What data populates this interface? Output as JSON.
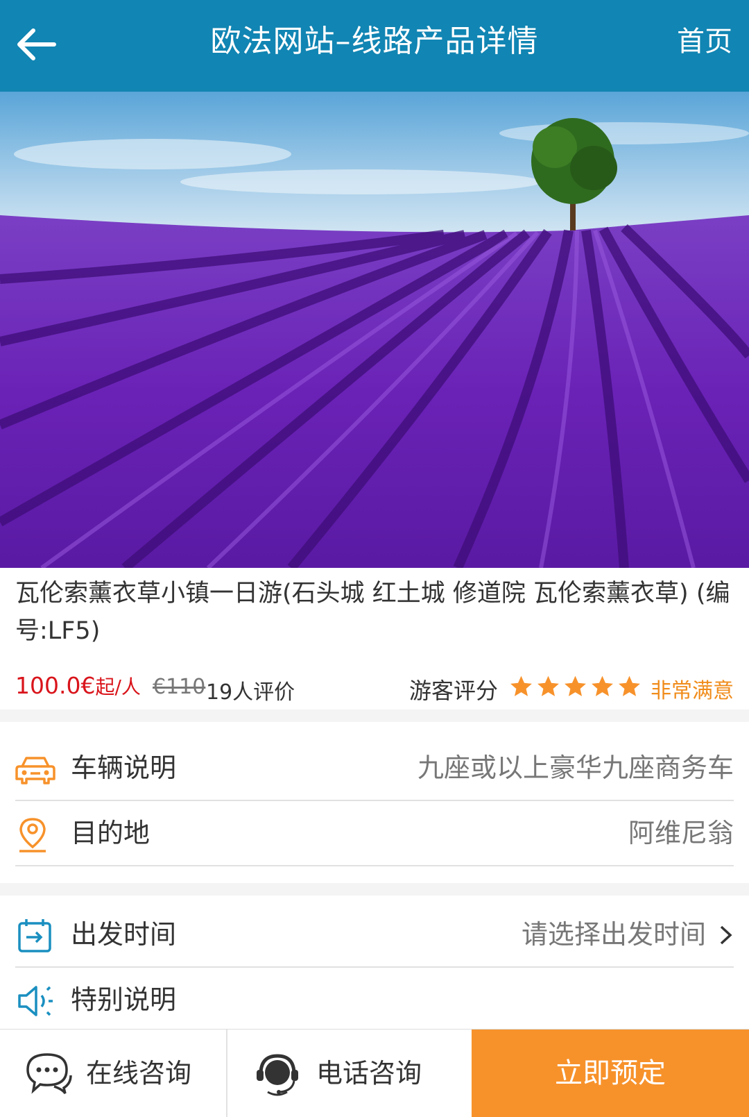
{
  "header": {
    "title": "欧法网站–线路产品详情",
    "home_label": "首页"
  },
  "product": {
    "title": "瓦伦索薰衣草小镇一日游(石头城 红土城 修道院 瓦伦索薰衣草) (编号:LF5)",
    "price": "100.0€",
    "price_unit": "起/人",
    "original_price": "€110",
    "review_count": "19人评价",
    "rating_label": "游客评分",
    "rating_stars": 5,
    "rating_text": "非常满意"
  },
  "details": [
    {
      "label": "车辆说明",
      "value": "九座或以上豪华九座商务车",
      "icon": "car-icon"
    },
    {
      "label": "目的地",
      "value": "阿维尼翁",
      "icon": "location-pin-icon"
    }
  ],
  "options": [
    {
      "label": "出发时间",
      "value": "请选择出发时间",
      "icon": "calendar-icon"
    },
    {
      "label": "特别说明",
      "value": "",
      "icon": "speaker-icon"
    }
  ],
  "bottom_bar": {
    "online_consult": "在线咨询",
    "phone_consult": "电话咨询",
    "book_now": "立即预定"
  },
  "colors": {
    "header_bg": "#1185b3",
    "price_red": "#d9141b",
    "accent_orange": "#f7922b",
    "icon_blue": "#1a8fc0"
  }
}
